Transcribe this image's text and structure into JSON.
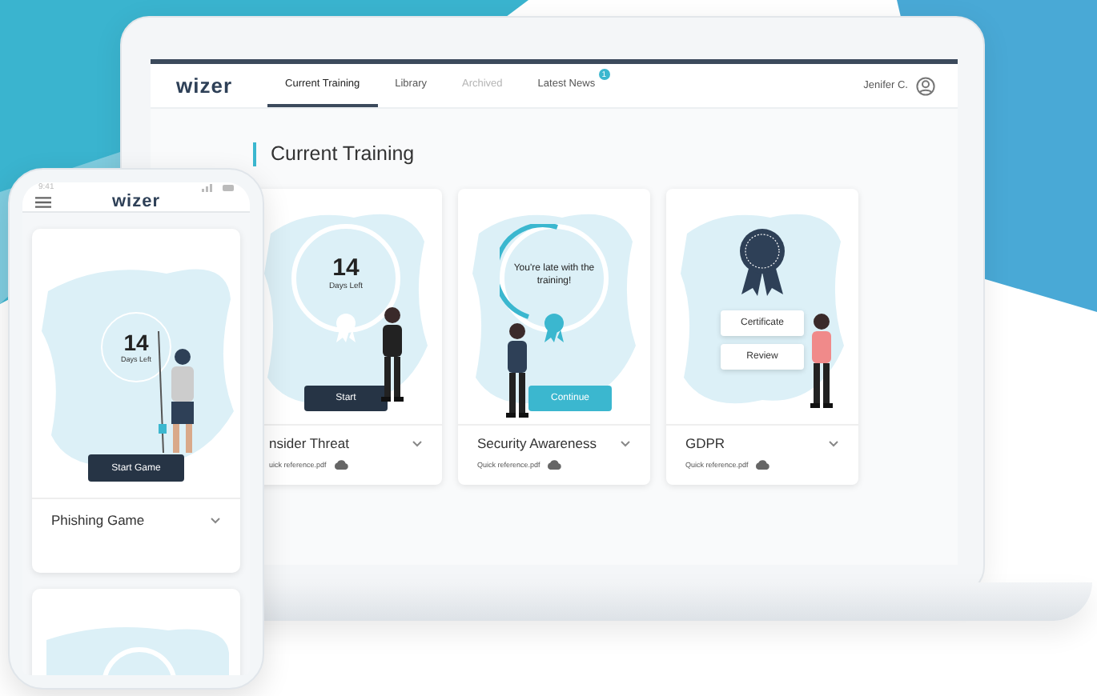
{
  "laptop": {
    "brand": "wizer",
    "nav_tabs": [
      {
        "label": "Current Training",
        "selected": true,
        "disabled": false
      },
      {
        "label": "Library",
        "selected": false,
        "disabled": false
      },
      {
        "label": "Archived",
        "selected": false,
        "disabled": true
      },
      {
        "label": "Latest News",
        "selected": false,
        "disabled": false,
        "badge": "1"
      }
    ],
    "user": "Jenifer C.",
    "heading": "Current Training",
    "cards": [
      {
        "kind": "countdown",
        "count": "14",
        "count_label": "Days Left",
        "buttons": [
          "Start"
        ],
        "title": "nsider Threat",
        "attachment": "uick reference.pdf"
      },
      {
        "kind": "late",
        "message": "You're late with the training!",
        "buttons": [
          "Continue"
        ],
        "title": "Security Awareness",
        "attachment": "Quick reference.pdf"
      },
      {
        "kind": "completed",
        "buttons": [
          "Certificate",
          "Review"
        ],
        "title": "GDPR",
        "attachment": "Quick reference.pdf"
      }
    ]
  },
  "phone": {
    "time": "9:41",
    "brand": "wizer",
    "cards": [
      {
        "count": "14",
        "count_label": "Days Left",
        "button": "Start Game",
        "title": "Phishing Game"
      }
    ]
  }
}
